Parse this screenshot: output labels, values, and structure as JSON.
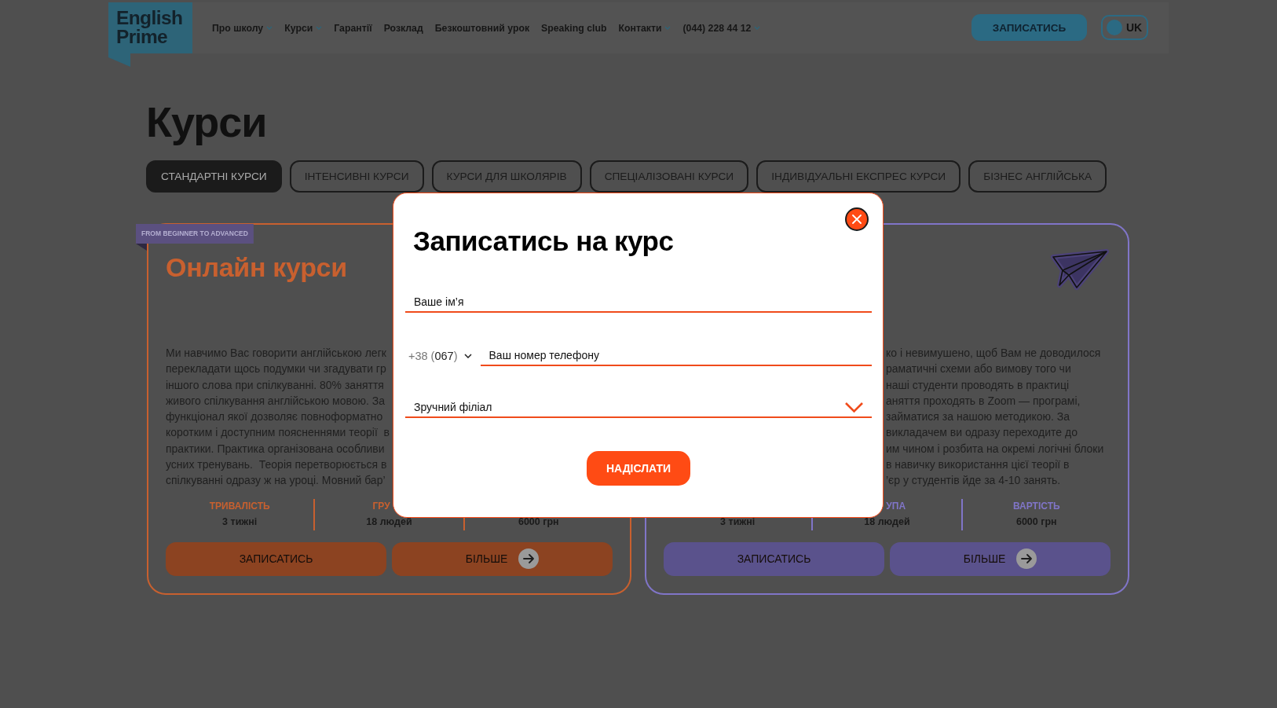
{
  "header": {
    "logo": [
      "English",
      "Prime"
    ],
    "nav": [
      {
        "label": "Про школу",
        "dropdown": true
      },
      {
        "label": "Курси",
        "dropdown": true
      },
      {
        "label": "Гарантії",
        "dropdown": false
      },
      {
        "label": "Розклад",
        "dropdown": false
      },
      {
        "label": "Безкоштовний урок",
        "dropdown": false
      },
      {
        "label": "Speaking club",
        "dropdown": false
      },
      {
        "label": "Контакти",
        "dropdown": true
      },
      {
        "label": "(044) 228 44 12",
        "dropdown": true
      }
    ],
    "signup_button": "ЗАПИСАТИСЬ",
    "language": "UK"
  },
  "page": {
    "title": "Курси",
    "tabs": [
      {
        "label": "СТАНДАРТНІ КУРСИ",
        "selected": true
      },
      {
        "label": "ІНТЕНСИВНІ КУРСИ",
        "selected": false
      },
      {
        "label": "КУРСИ ДЛЯ ШКОЛЯРІВ",
        "selected": false
      },
      {
        "label": "СПЕЦІАЛІЗОВАНІ КУРСИ",
        "selected": false
      },
      {
        "label": "ІНДИВІДУАЛЬНІ ЕКСПРЕС КУРСИ",
        "selected": false
      },
      {
        "label": "БІЗНЕС АНГЛІЙСЬКА",
        "selected": false
      }
    ]
  },
  "cards": [
    {
      "color": "#c8602f",
      "badge": "FROM BEGINNER TO ADVANCED",
      "title": "Онлайн курси",
      "icon": false,
      "text_lines": [
        "Ми навчимо Вас говорити англійською легк",
        "перекладати щось подумки чи згадувати гр",
        "іншого слова при спілкуванні. 80% заняття",
        "живого спілкування англійською мовою. За",
        "функціонал якої дозволяє повноформатно",
        "коротким і доступним поясненнями теорії  в",
        "практики. Практика організована особливи",
        "усних тренувань.  Теорія перетворюється в",
        "спілкуванні одразу ж на уроці. Мовний бар’"
      ],
      "stats": [
        {
          "label": "ТРИВАЛІСТЬ",
          "value": "3 тижні"
        },
        {
          "label": "ГРУ",
          "value": "18 людей"
        },
        {
          "value": "6000 грн"
        }
      ],
      "enroll_button": "ЗАПИСАТИСЬ",
      "more_button": "БІЛЬШЕ"
    },
    {
      "color": "#8075c8",
      "icon": true,
      "text_lines": [
        "ко і невимушено, щоб Вам не доводилося",
        "раматичні схеми або вимову того чи",
        "наші студенти проводять в практиці",
        "аняття проходять в Zoom — програмі,",
        "займатися за нашою методикою. За",
        "викладачем ви одразу переходите до",
        "им чином і розбита на окремі логічні блоки",
        "в навичку використання цієї теорії в",
        "’єр у студентів йде за 4-10 занять."
      ],
      "stats": [
        {
          "value": "3 тижні"
        },
        {
          "label": "УПА",
          "value": "18 людей"
        },
        {
          "label": "ВАРТІСТЬ",
          "value": "6000 грн"
        }
      ],
      "enroll_button": "ЗАПИСАТИСЬ",
      "more_button": "БІЛЬШЕ"
    }
  ],
  "modal": {
    "title": "Записатись на курс",
    "name_field": {
      "placeholder": "Ваше ім’я"
    },
    "phone": {
      "code_prefix": "+38 (",
      "code": "067",
      "code_suffix": ")",
      "placeholder": "Ваш номер телефону"
    },
    "branch_select": {
      "placeholder": "Зручний філіал"
    },
    "submit_button": "НАДІСЛАТИ"
  }
}
